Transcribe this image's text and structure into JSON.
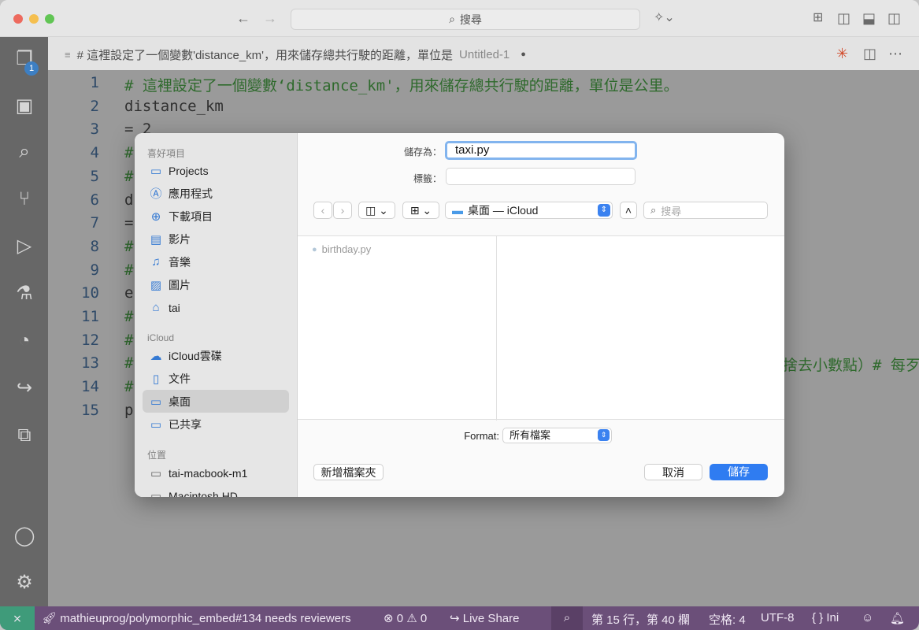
{
  "titlebar": {
    "search_text": "搜尋",
    "search_icon": "magnifier-icon"
  },
  "activity": {
    "explorer_badge": "1"
  },
  "tab": {
    "breadcrumb": "# 這裡設定了一個變數'distance_km'，用來儲存總共行駛的距離，單位是",
    "title": "Untitled-1"
  },
  "editor": {
    "line_numbers": [
      "1",
      "2",
      "3",
      "4",
      "5",
      "6",
      "7",
      "8",
      "9",
      "10",
      "11",
      "12",
      "13",
      "14",
      "15"
    ],
    "lines": [
      "# 這裡設定了一個變數‘distance_km'，用來儲存總共行駛的距離，單位是公里。",
      "distance_km",
      "= 2",
      "#",
      "#",
      "d",
      "=",
      "#",
      "#",
      "e",
      "#",
      "#",
      "#",
      "#",
      "p"
    ],
    "overflow_text": "捨去小數點）# 每歹"
  },
  "status": {
    "remote": "⨯",
    "repo": "mathieuprog/polymorphic_embed#134 needs reviewers",
    "errors": "0",
    "warnings": "0",
    "live_share": "Live Share",
    "position": "第 15 行，第 40 欄",
    "spaces": "空格: 4",
    "encoding": "UTF-8",
    "language": "{ } Ini"
  },
  "dialog": {
    "favorites_header": "喜好項目",
    "favorites": [
      {
        "label": "Projects",
        "icon": "folder-icon"
      },
      {
        "label": "應用程式",
        "icon": "applications-icon"
      },
      {
        "label": "下載項目",
        "icon": "download-icon"
      },
      {
        "label": "影片",
        "icon": "film-icon"
      },
      {
        "label": "音樂",
        "icon": "music-icon"
      },
      {
        "label": "圖片",
        "icon": "photo-icon"
      },
      {
        "label": "tai",
        "icon": "home-icon"
      }
    ],
    "icloud_header": "iCloud",
    "icloud": [
      {
        "label": "iCloud雲碟",
        "icon": "cloud-icon"
      },
      {
        "label": "文件",
        "icon": "document-icon"
      },
      {
        "label": "桌面",
        "icon": "desktop-icon"
      },
      {
        "label": "已共享",
        "icon": "shared-folder-icon"
      }
    ],
    "locations_header": "位置",
    "locations": [
      {
        "label": "tai-macbook-m1",
        "icon": "laptop-icon"
      },
      {
        "label": "Macintosh HD",
        "icon": "disk-icon"
      }
    ],
    "save_as_label": "儲存為：",
    "save_as_value": "taxi.py",
    "tags_label": "標籤：",
    "tags_value": "",
    "path_label": "桌面 — iCloud",
    "search_placeholder": "搜尋",
    "file_name": "birthday.py",
    "format_label": "Format:",
    "format_value": "所有檔案",
    "new_folder_label": "新增檔案夾",
    "cancel_label": "取消",
    "save_label": "儲存",
    "accent_color": "#2f7cf1"
  }
}
